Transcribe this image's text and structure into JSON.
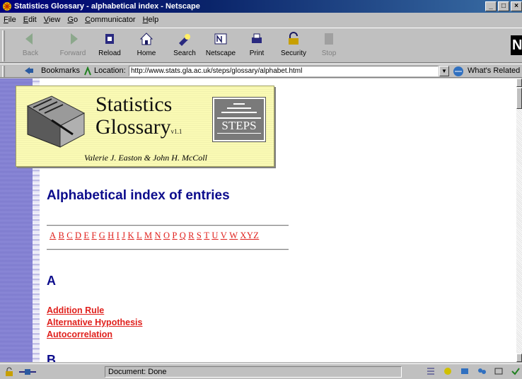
{
  "window": {
    "title": "Statistics Glossary - alphabetical index - Netscape",
    "buttons": [
      "_",
      "□",
      "×"
    ]
  },
  "menu": [
    "File",
    "Edit",
    "View",
    "Go",
    "Communicator",
    "Help"
  ],
  "toolbar": {
    "back": "Back",
    "forward": "Forward",
    "reload": "Reload",
    "home": "Home",
    "search": "Search",
    "netscape": "Netscape",
    "print": "Print",
    "security": "Security",
    "stop": "Stop"
  },
  "location": {
    "bookmarks_label": "Bookmarks",
    "location_label": "Location:",
    "url": "http://www.stats.gla.ac.uk/steps/glossary/alphabet.html",
    "whats_related": "What's Related"
  },
  "banner": {
    "title_line1": "Statistics",
    "title_line2": "Glossary",
    "version": "v1.1",
    "authors": "Valerie J. Easton & John H. McColl",
    "logo_text": "STEPS"
  },
  "content": {
    "heading": "Alphabetical index of entries",
    "letters": [
      "A",
      "B",
      "C",
      "D",
      "E",
      "F",
      "G",
      "H",
      "I",
      "J",
      "K",
      "L",
      "M",
      "N",
      "O",
      "P",
      "Q",
      "R",
      "S",
      "T",
      "U",
      "V",
      "W",
      "XYZ"
    ],
    "sections": [
      {
        "letter": "A",
        "entries": [
          "Addition Rule",
          "Alternative Hypothesis",
          "Autocorrelation"
        ]
      },
      {
        "letter": "B",
        "entries": []
      }
    ]
  },
  "status": {
    "text": "Document: Done"
  },
  "colors": {
    "heading": "#0c0c8c",
    "link": "#e0201c",
    "sidebar": "#7f7ccf",
    "banner_bg": "#fafab4"
  }
}
